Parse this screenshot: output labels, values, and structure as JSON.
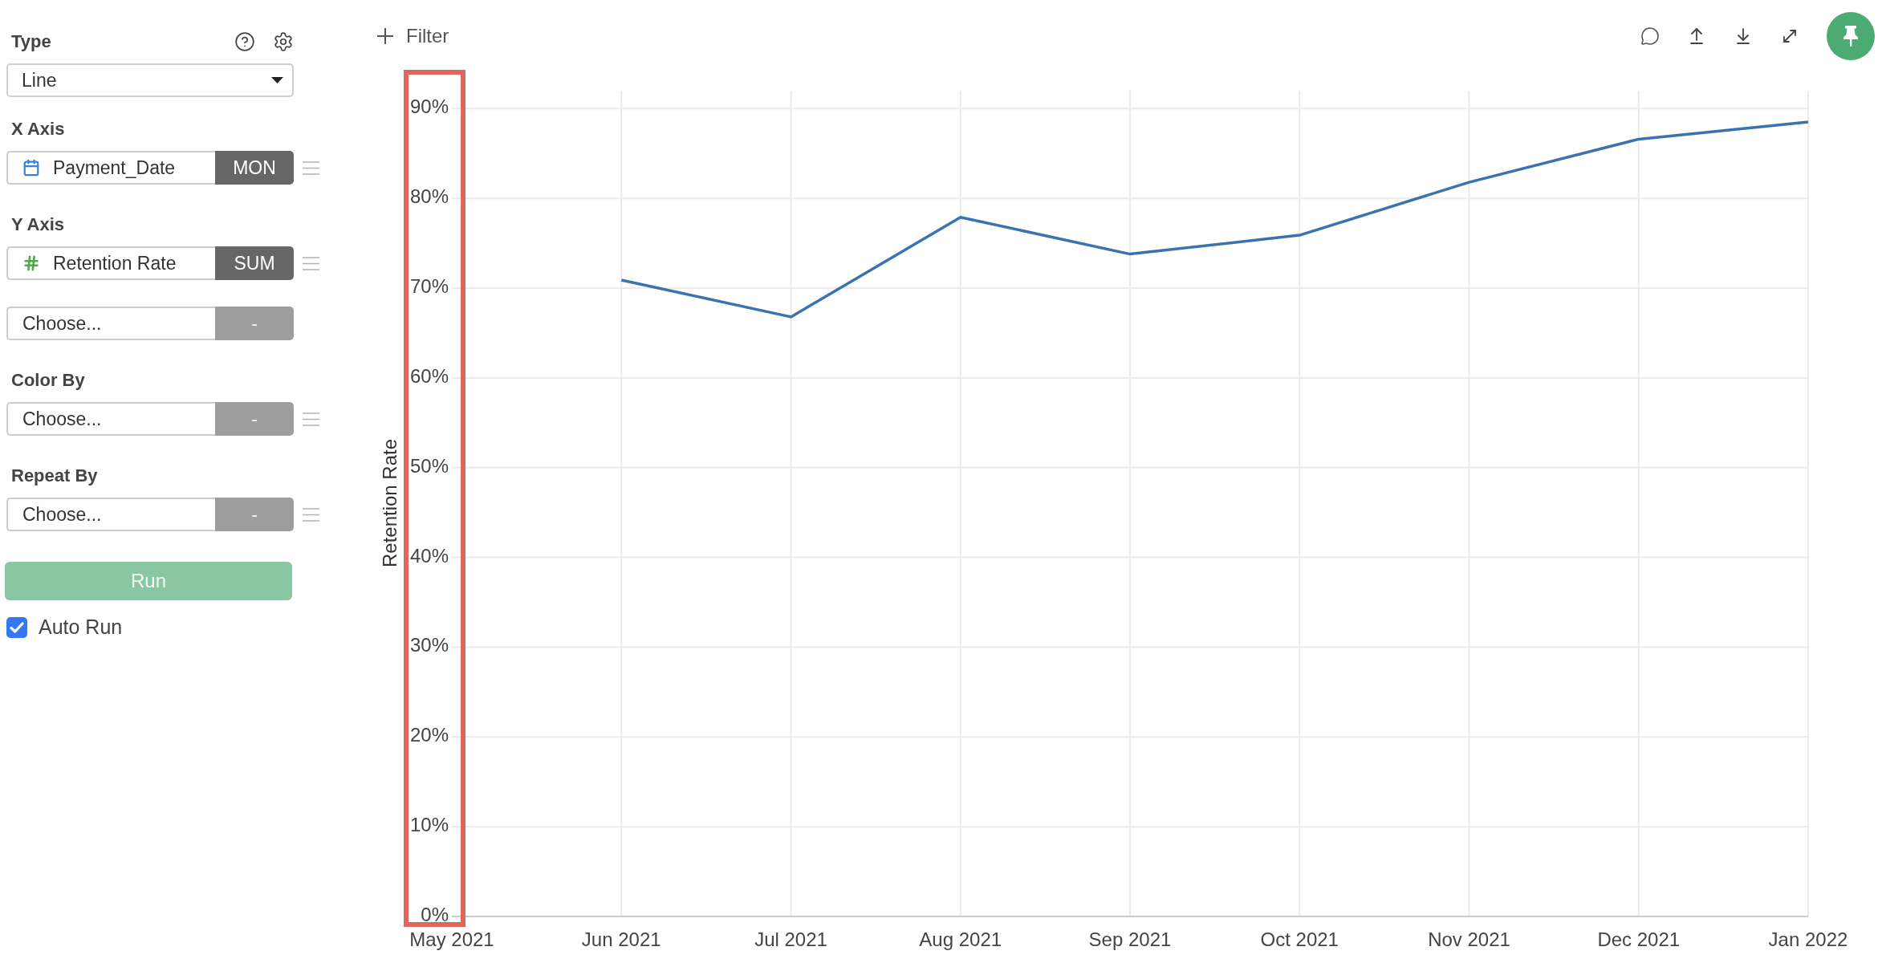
{
  "sidebar": {
    "type": {
      "label": "Type",
      "value": "Line"
    },
    "sections": [
      {
        "label": "X Axis",
        "fields": [
          {
            "kind": "date",
            "value": "Payment_Date",
            "aggregation": "MON",
            "menu": true
          }
        ]
      },
      {
        "label": "Y Axis",
        "fields": [
          {
            "kind": "number",
            "value": "Retention Rate",
            "aggregation": "SUM",
            "menu": true
          },
          {
            "kind": "empty",
            "value": "Choose...",
            "aggregation": "-",
            "menu": false
          }
        ]
      },
      {
        "label": "Color By",
        "fields": [
          {
            "kind": "empty",
            "value": "Choose...",
            "aggregation": "-",
            "menu": true
          }
        ]
      },
      {
        "label": "Repeat By",
        "fields": [
          {
            "kind": "empty",
            "value": "Choose...",
            "aggregation": "-",
            "menu": true
          }
        ]
      }
    ],
    "run_button": {
      "label": "Run",
      "disabled": true
    },
    "auto_run": {
      "label": "Auto Run",
      "checked": true
    }
  },
  "toolbar": {
    "filter_label": "Filter"
  },
  "chart": {
    "chart_data": {
      "type": "line",
      "ylabel": "Retention Rate",
      "grid": true,
      "categories": [
        "May 2021",
        "Jun 2021",
        "Jul 2021",
        "Aug 2021",
        "Sep 2021",
        "Oct 2021",
        "Nov 2021",
        "Dec 2021",
        "Jan 2022"
      ],
      "series": [
        {
          "color": "#3a73b0",
          "values": [
            null,
            0.709,
            0.668,
            0.779,
            0.738,
            0.759,
            0.818,
            0.866,
            0.885
          ]
        }
      ],
      "ylim": [
        0,
        0.92
      ],
      "yticks": [
        {
          "value": 0,
          "label": "0%"
        },
        {
          "value": 0.1,
          "label": "10%"
        },
        {
          "value": 0.2,
          "label": "20%"
        },
        {
          "value": 0.3,
          "label": "30%"
        },
        {
          "value": 0.4,
          "label": "40%"
        },
        {
          "value": 0.5,
          "label": "50%"
        },
        {
          "value": 0.6,
          "label": "60%"
        },
        {
          "value": 0.7,
          "label": "70%"
        },
        {
          "value": 0.8,
          "label": "80%"
        },
        {
          "value": 0.9,
          "label": "90%"
        }
      ]
    }
  }
}
